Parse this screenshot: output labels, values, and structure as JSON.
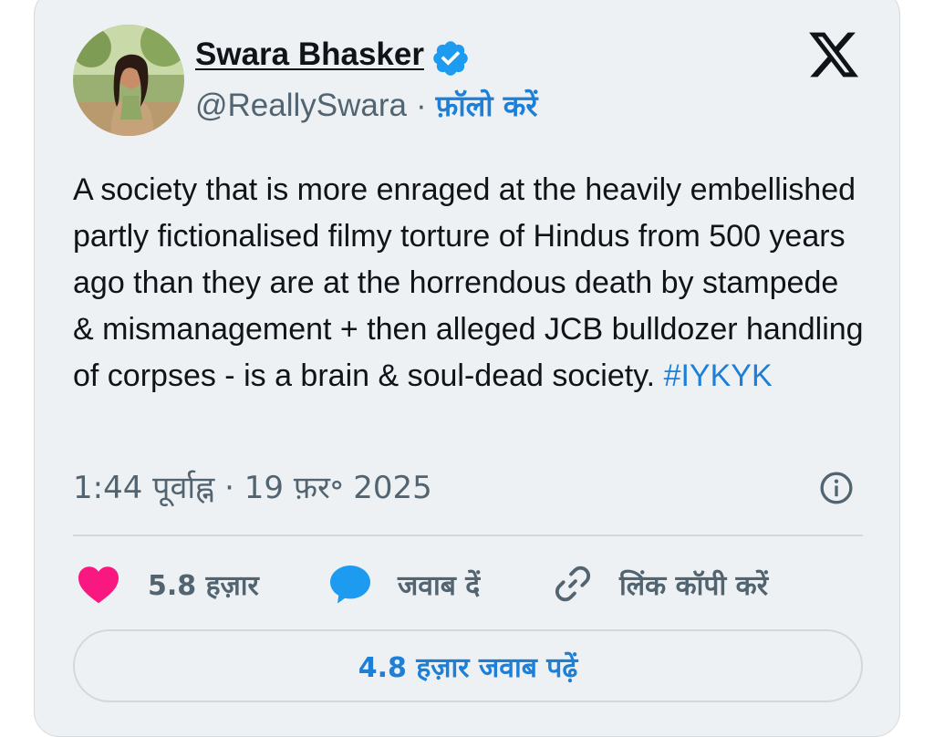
{
  "author": {
    "name": "Swara Bhasker",
    "handle": "@ReallySwara",
    "separator": "·",
    "follow_label": "फ़ॉलो करें",
    "verified": true
  },
  "tweet": {
    "text": "A society that is more enraged at the heavily embellished partly fictionalised filmy torture of Hindus from 500 years ago than they are at the horrendous death by stampede & mismanagement + then alleged JCB bulldozer handling of corpses - is a brain & soul-dead society.",
    "hashtag": "#IYKYK",
    "timestamp": "1:44 पूर्वाह्न · 19 फ़र॰ 2025"
  },
  "actions": {
    "likes_label": "5.8 हज़ार",
    "reply_label": "जवाब दें",
    "copy_link_label": "लिंक कॉपी करें"
  },
  "read_replies_label": "4.8 हज़ार जवाब पढ़ें",
  "icons": {
    "x_logo": "x-logo-icon",
    "verified": "verified-badge-icon",
    "info": "info-icon",
    "like": "heart-icon",
    "reply": "speech-bubble-icon",
    "link": "link-icon"
  },
  "colors": {
    "accent": "#1d7fd6",
    "heart": "#f91880",
    "card_bg": "#edf1f4",
    "text": "#0f1419",
    "muted": "#536471"
  }
}
